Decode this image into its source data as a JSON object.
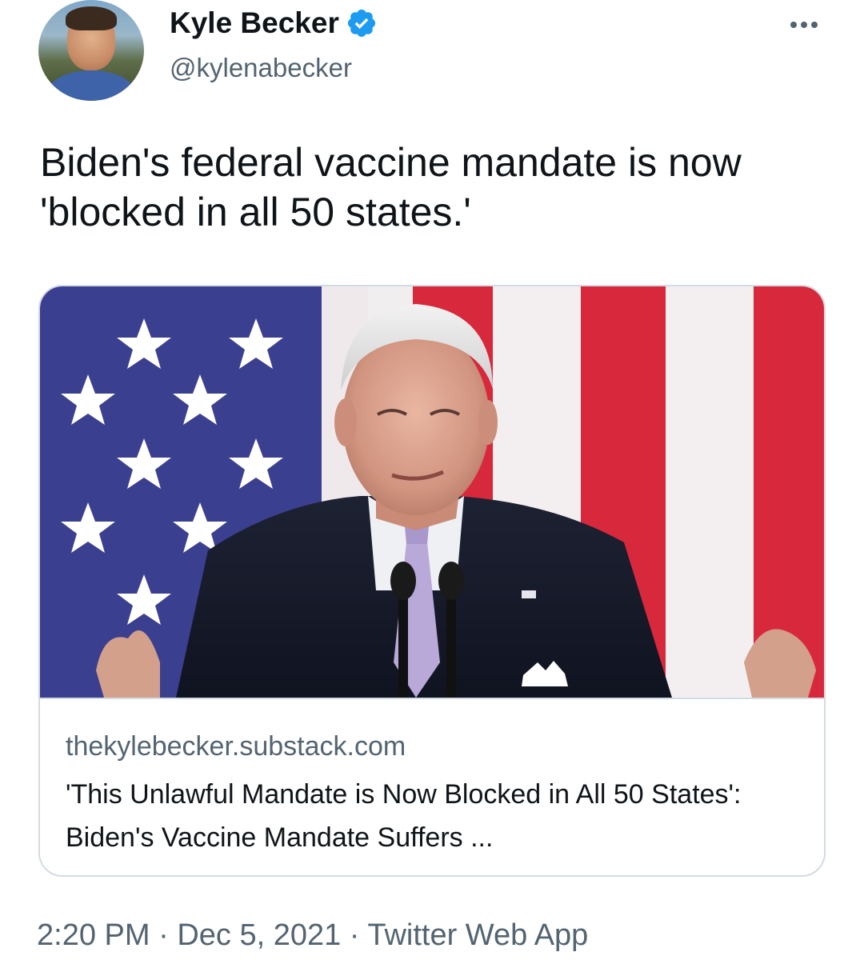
{
  "author": {
    "display_name": "Kyle Becker",
    "handle": "@kylenabecker",
    "verified": true
  },
  "icons": {
    "verified": "verified-badge-icon",
    "more": "more-options-icon"
  },
  "tweet": {
    "text": "Biden's federal vaccine mandate is now 'blocked in all 50 states.'"
  },
  "card": {
    "domain": "thekylebecker.substack.com",
    "title": "'This Unlawful Mandate is Now Blocked in All 50 States': Biden's Vaccine Mandate Suffers ..."
  },
  "footer": {
    "time": "2:20 PM",
    "separator": "·",
    "date": "Dec 5, 2021",
    "source": "Twitter Web App"
  },
  "colors": {
    "verified_blue": "#1d9bf0",
    "secondary_text": "#536471",
    "flag_red": "#d8283c",
    "flag_blue": "#3b3f8f"
  }
}
